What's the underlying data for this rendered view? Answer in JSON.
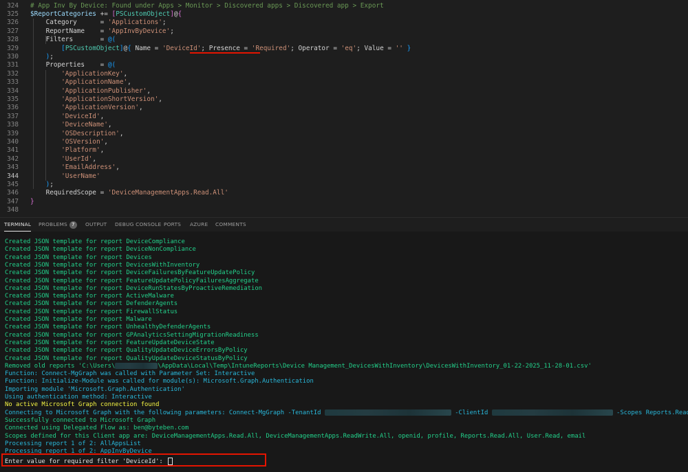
{
  "editor": {
    "lines": [
      {
        "n": "324",
        "segs": [
          {
            "c": "c-com",
            "t": "# App Inv By Device: Found under Apps > Monitor > Discovered apps > Discovered app > Export"
          }
        ]
      },
      {
        "n": "325",
        "segs": [
          {
            "c": "c-var",
            "t": "$ReportCategories"
          },
          {
            "c": "c-plain",
            "t": " += "
          },
          {
            "c": "c-br",
            "t": "["
          },
          {
            "c": "c-type",
            "t": "PSCustomObject"
          },
          {
            "c": "c-br",
            "t": "]"
          },
          {
            "c": "c-plain",
            "t": "@"
          },
          {
            "c": "c-br",
            "t": "{"
          }
        ]
      },
      {
        "n": "326",
        "segs": [
          {
            "c": "c-plain",
            "t": "    Category      = "
          },
          {
            "c": "c-str",
            "t": "'Applications'"
          },
          {
            "c": "c-plain",
            "t": ";"
          }
        ]
      },
      {
        "n": "327",
        "segs": [
          {
            "c": "c-plain",
            "t": "    ReportName    = "
          },
          {
            "c": "c-str",
            "t": "'AppInvByDevice'"
          },
          {
            "c": "c-plain",
            "t": ";"
          }
        ]
      },
      {
        "n": "328",
        "segs": [
          {
            "c": "c-plain",
            "t": "    Filters       = "
          },
          {
            "c": "c-br2",
            "t": "@("
          }
        ]
      },
      {
        "n": "329",
        "segs": [
          {
            "c": "c-plain",
            "t": "        "
          },
          {
            "c": "c-br2",
            "t": "["
          },
          {
            "c": "c-type",
            "t": "PSCustomObject"
          },
          {
            "c": "c-br2",
            "t": "]"
          },
          {
            "c": "c-plain",
            "t": "@"
          },
          {
            "c": "c-br2",
            "t": "{"
          },
          {
            "c": "c-plain",
            "t": " Name = "
          },
          {
            "c": "c-str",
            "t": "'DeviceId'"
          },
          {
            "c": "c-plain",
            "t": "; Presence = "
          },
          {
            "c": "c-str",
            "t": "'Required'"
          },
          {
            "c": "c-plain",
            "t": "; Operator = "
          },
          {
            "c": "c-str",
            "t": "'eq'"
          },
          {
            "c": "c-plain",
            "t": "; Value = "
          },
          {
            "c": "c-str",
            "t": "''"
          },
          {
            "c": "c-plain",
            "t": " "
          },
          {
            "c": "c-br2",
            "t": "}"
          }
        ]
      },
      {
        "n": "330",
        "segs": [
          {
            "c": "c-plain",
            "t": "    "
          },
          {
            "c": "c-br2",
            "t": ")"
          },
          {
            "c": "c-plain",
            "t": ";"
          }
        ]
      },
      {
        "n": "331",
        "segs": [
          {
            "c": "c-plain",
            "t": "    Properties    = "
          },
          {
            "c": "c-br2",
            "t": "@("
          }
        ]
      },
      {
        "n": "332",
        "segs": [
          {
            "c": "c-plain",
            "t": "        "
          },
          {
            "c": "c-str",
            "t": "'ApplicationKey'"
          },
          {
            "c": "c-plain",
            "t": ","
          }
        ]
      },
      {
        "n": "333",
        "segs": [
          {
            "c": "c-plain",
            "t": "        "
          },
          {
            "c": "c-str",
            "t": "'ApplicationName'"
          },
          {
            "c": "c-plain",
            "t": ","
          }
        ]
      },
      {
        "n": "334",
        "segs": [
          {
            "c": "c-plain",
            "t": "        "
          },
          {
            "c": "c-str",
            "t": "'ApplicationPublisher'"
          },
          {
            "c": "c-plain",
            "t": ","
          }
        ]
      },
      {
        "n": "335",
        "segs": [
          {
            "c": "c-plain",
            "t": "        "
          },
          {
            "c": "c-str",
            "t": "'ApplicationShortVersion'"
          },
          {
            "c": "c-plain",
            "t": ","
          }
        ]
      },
      {
        "n": "336",
        "segs": [
          {
            "c": "c-plain",
            "t": "        "
          },
          {
            "c": "c-str",
            "t": "'ApplicationVersion'"
          },
          {
            "c": "c-plain",
            "t": ","
          }
        ]
      },
      {
        "n": "337",
        "segs": [
          {
            "c": "c-plain",
            "t": "        "
          },
          {
            "c": "c-str",
            "t": "'DeviceId'"
          },
          {
            "c": "c-plain",
            "t": ","
          }
        ]
      },
      {
        "n": "338",
        "segs": [
          {
            "c": "c-plain",
            "t": "        "
          },
          {
            "c": "c-str",
            "t": "'DeviceName'"
          },
          {
            "c": "c-plain",
            "t": ","
          }
        ]
      },
      {
        "n": "339",
        "segs": [
          {
            "c": "c-plain",
            "t": "        "
          },
          {
            "c": "c-str",
            "t": "'OSDescription'"
          },
          {
            "c": "c-plain",
            "t": ","
          }
        ]
      },
      {
        "n": "340",
        "segs": [
          {
            "c": "c-plain",
            "t": "        "
          },
          {
            "c": "c-str",
            "t": "'OSVersion'"
          },
          {
            "c": "c-plain",
            "t": ","
          }
        ]
      },
      {
        "n": "341",
        "segs": [
          {
            "c": "c-plain",
            "t": "        "
          },
          {
            "c": "c-str",
            "t": "'Platform'"
          },
          {
            "c": "c-plain",
            "t": ","
          }
        ]
      },
      {
        "n": "342",
        "segs": [
          {
            "c": "c-plain",
            "t": "        "
          },
          {
            "c": "c-str",
            "t": "'UserId'"
          },
          {
            "c": "c-plain",
            "t": ","
          }
        ]
      },
      {
        "n": "343",
        "segs": [
          {
            "c": "c-plain",
            "t": "        "
          },
          {
            "c": "c-str",
            "t": "'EmailAddress'"
          },
          {
            "c": "c-plain",
            "t": ","
          }
        ]
      },
      {
        "n": "344",
        "segs": [
          {
            "c": "c-plain",
            "t": "        "
          },
          {
            "c": "c-str",
            "t": "'UserName'"
          }
        ]
      },
      {
        "n": "345",
        "segs": [
          {
            "c": "c-plain",
            "t": "    "
          },
          {
            "c": "c-br2",
            "t": ")"
          },
          {
            "c": "c-plain",
            "t": ";"
          }
        ]
      },
      {
        "n": "346",
        "segs": [
          {
            "c": "c-plain",
            "t": "    RequiredScope = "
          },
          {
            "c": "c-str",
            "t": "'DeviceManagementApps.Read.All'"
          }
        ]
      },
      {
        "n": "347",
        "segs": [
          {
            "c": "c-br",
            "t": "}"
          }
        ]
      },
      {
        "n": "348",
        "segs": []
      }
    ]
  },
  "panel": {
    "tabs": [
      {
        "label": "TERMINAL",
        "active": true
      },
      {
        "label": "PROBLEMS",
        "badge": "7"
      },
      {
        "label": "OUTPUT"
      },
      {
        "label": "DEBUG CONSOLE"
      },
      {
        "label": "PORTS"
      },
      {
        "label": "AZURE"
      },
      {
        "label": "COMMENTS"
      }
    ]
  },
  "terminal": {
    "lines": [
      {
        "c": "t-green",
        "segs": [
          {
            "t": "Created JSON template for report DeviceCompliance"
          }
        ]
      },
      {
        "c": "t-green",
        "segs": [
          {
            "t": "Created JSON template for report DeviceNonCompliance"
          }
        ]
      },
      {
        "c": "t-green",
        "segs": [
          {
            "t": "Created JSON template for report Devices"
          }
        ]
      },
      {
        "c": "t-green",
        "segs": [
          {
            "t": "Created JSON template for report DevicesWithInventory"
          }
        ]
      },
      {
        "c": "t-green",
        "segs": [
          {
            "t": "Created JSON template for report DeviceFailuresByFeatureUpdatePolicy"
          }
        ]
      },
      {
        "c": "t-green",
        "segs": [
          {
            "t": "Created JSON template for report FeatureUpdatePolicyFailuresAggregate"
          }
        ]
      },
      {
        "c": "t-green",
        "segs": [
          {
            "t": "Created JSON template for report DeviceRunStatesByProactiveRemediation"
          }
        ]
      },
      {
        "c": "t-green",
        "segs": [
          {
            "t": "Created JSON template for report ActiveMalware"
          }
        ]
      },
      {
        "c": "t-green",
        "segs": [
          {
            "t": "Created JSON template for report DefenderAgents"
          }
        ]
      },
      {
        "c": "t-green",
        "segs": [
          {
            "t": "Created JSON template for report FirewallStatus"
          }
        ]
      },
      {
        "c": "t-green",
        "segs": [
          {
            "t": "Created JSON template for report Malware"
          }
        ]
      },
      {
        "c": "t-green",
        "segs": [
          {
            "t": "Created JSON template for report UnhealthyDefenderAgents"
          }
        ]
      },
      {
        "c": "t-green",
        "segs": [
          {
            "t": "Created JSON template for report GPAnalyticsSettingMigrationReadiness"
          }
        ]
      },
      {
        "c": "t-green",
        "segs": [
          {
            "t": "Created JSON template for report FeatureUpdateDeviceState"
          }
        ]
      },
      {
        "c": "t-green",
        "segs": [
          {
            "t": "Created JSON template for report QualityUpdateDeviceErrorsByPolicy"
          }
        ]
      },
      {
        "c": "t-green",
        "segs": [
          {
            "t": "Created JSON template for report QualityUpdateDeviceStatusByPolicy"
          }
        ]
      },
      {
        "c": "t-green",
        "segs": [
          {
            "t": "Removed old reports 'C:\\Users\\"
          },
          {
            "redact": 62
          },
          {
            "t": "\\AppData\\Local\\Temp\\IntuneReports\\Device Management_DevicesWithInventory\\DevicesWithInventory_01-22-2025_11-28-01.csv'"
          }
        ]
      },
      {
        "c": "t-cyan",
        "segs": [
          {
            "t": "Function: Connect-MgGraph was called with Parameter Set: Interactive"
          }
        ]
      },
      {
        "c": "t-cyan",
        "segs": [
          {
            "t": "Function: Initialize-Module was called for module(s): Microsoft.Graph.Authentication"
          }
        ]
      },
      {
        "c": "t-cyan",
        "segs": [
          {
            "t": "Importing module 'Microsoft.Graph.Authentication'"
          }
        ]
      },
      {
        "c": "t-cyan",
        "segs": [
          {
            "t": "Using authentication method: Interactive"
          }
        ]
      },
      {
        "c": "t-yellow",
        "segs": [
          {
            "t": "No active Microsoft Graph connection found"
          }
        ]
      },
      {
        "c": "t-cyan",
        "segs": [
          {
            "t": "Connecting to Microsoft Graph with the following parameters: Connect-MgGraph -TenantId "
          },
          {
            "redact": 184
          },
          {
            "t": " -ClientId "
          },
          {
            "redact": 176
          },
          {
            "t": " -Scopes Reports.Read.All"
          }
        ]
      },
      {
        "c": "t-green",
        "segs": [
          {
            "t": "Successfully connected to Microsoft Graph"
          }
        ]
      },
      {
        "c": "t-green",
        "segs": [
          {
            "t": "Connected using Delegated Flow as: ben@byteben.com"
          }
        ]
      },
      {
        "c": "t-green",
        "segs": [
          {
            "t": "Scopes defined for this Client app are: DeviceManagementApps.Read.All, DeviceManagementApps.ReadWrite.All, openid, profile, Reports.Read.All, User.Read, email"
          }
        ]
      },
      {
        "c": "t-cyan",
        "segs": [
          {
            "t": "Processing report 1 of 2: AllAppsList"
          }
        ]
      },
      {
        "c": "t-cyan",
        "segs": [
          {
            "t": "Processing report 1 of 2: AppInvByDevice"
          }
        ]
      }
    ],
    "prompt": "Enter value for required filter 'DeviceId': "
  }
}
